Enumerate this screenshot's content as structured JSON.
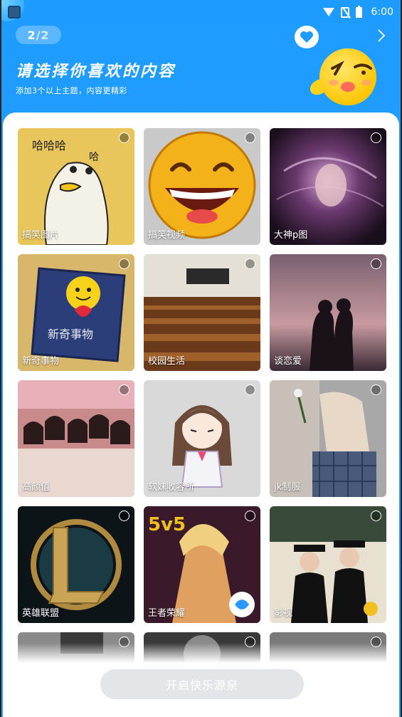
{
  "status_bar": {
    "time": "6:00",
    "icons": [
      "wifi-icon",
      "no-sim-icon",
      "battery-icon"
    ]
  },
  "header": {
    "step_current": "2",
    "step_separator": "/",
    "step_total": "2",
    "title": "请选择你喜欢的内容",
    "subtitle": "添加3个以上主题，内容更精彩",
    "heart_icon": "heart-icon",
    "next_icon": "chevron-right-icon"
  },
  "colors": {
    "header_bg": "#1e9bff",
    "cta_bg": "#e4e5e8",
    "card_bg": "#ffffff"
  },
  "topics": [
    {
      "label": "搞笑图片",
      "selected": false
    },
    {
      "label": "搞笑视频",
      "selected": false
    },
    {
      "label": "大神p图",
      "selected": false
    },
    {
      "label": "新奇事物",
      "selected": false
    },
    {
      "label": "校园生活",
      "selected": false
    },
    {
      "label": "谈恋爱",
      "selected": false
    },
    {
      "label": "高颜值",
      "selected": false
    },
    {
      "label": "软妹收容所",
      "selected": false
    },
    {
      "label": "jk制服",
      "selected": false
    },
    {
      "label": "英雄联盟",
      "selected": false
    },
    {
      "label": "王者荣耀",
      "selected": false
    },
    {
      "label": "影视",
      "selected": false
    },
    {
      "label": "",
      "selected": false
    },
    {
      "label": "",
      "selected": false
    },
    {
      "label": "",
      "selected": false
    }
  ],
  "cta": {
    "label": "开启快乐源泉",
    "enabled": false
  }
}
